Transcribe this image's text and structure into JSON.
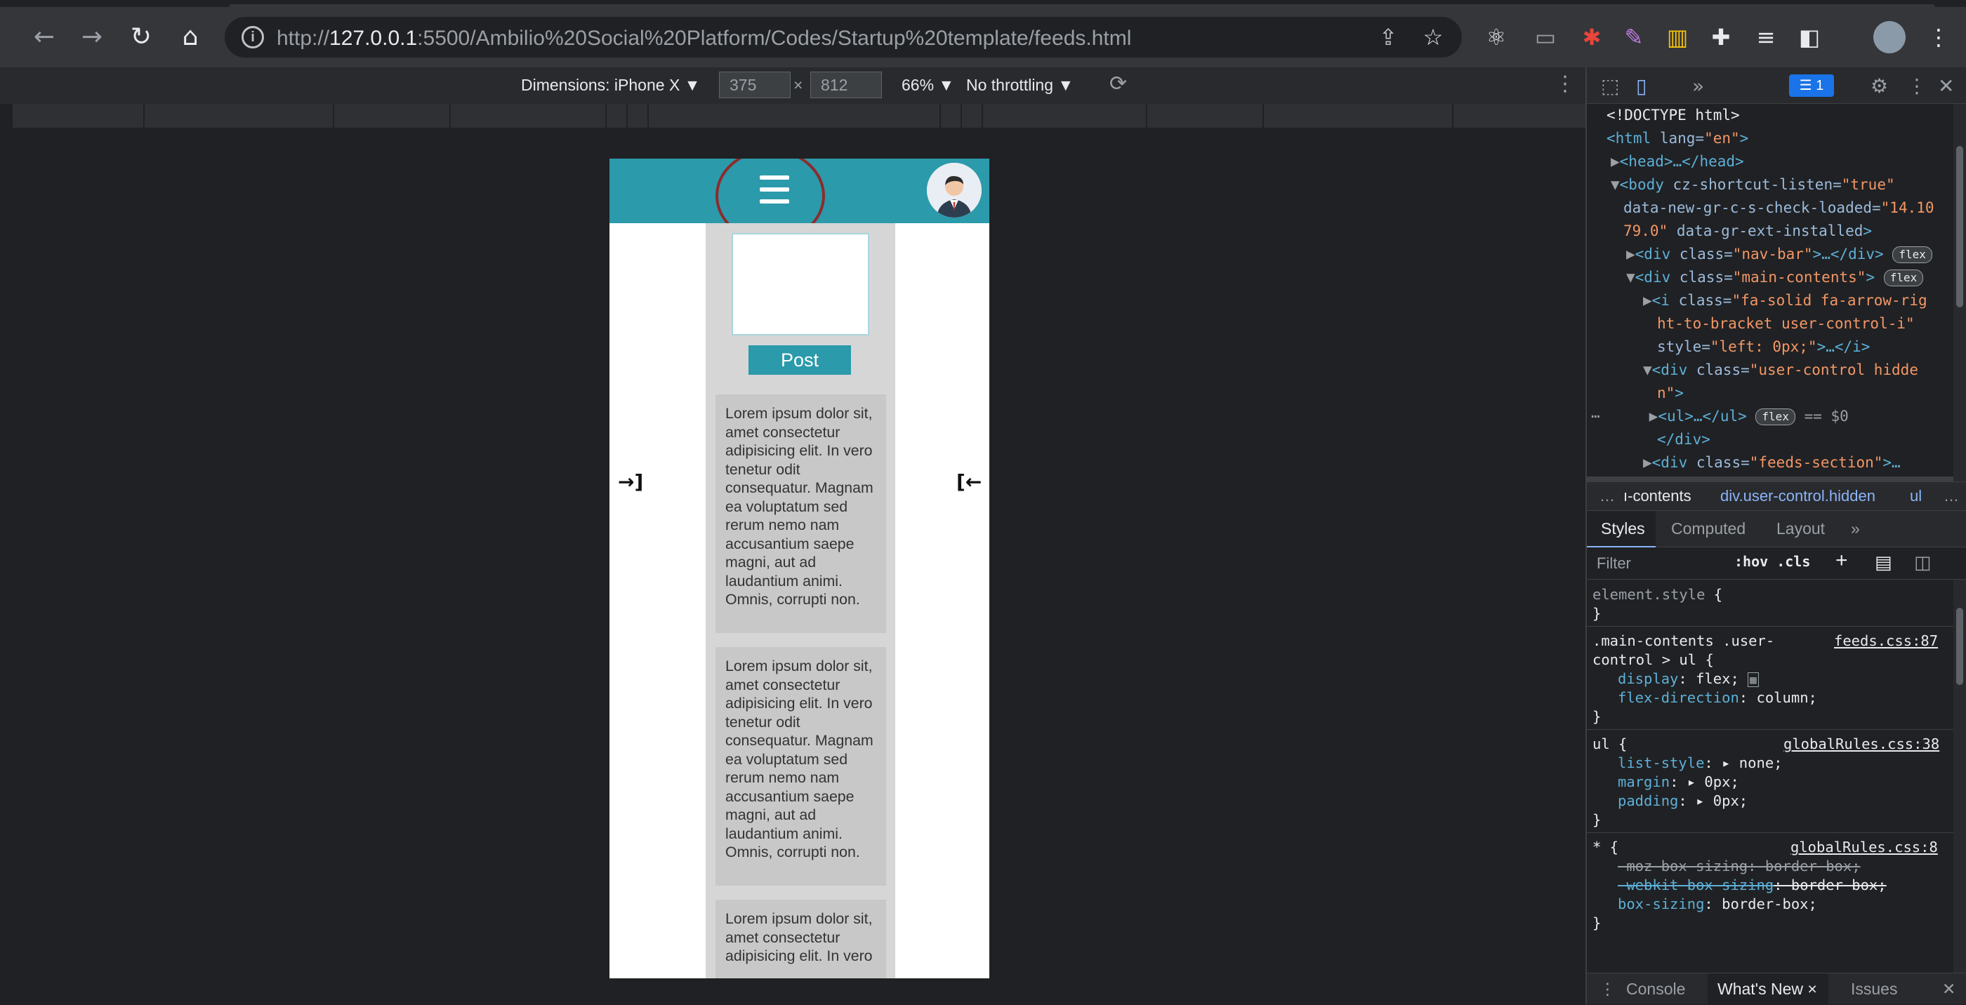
{
  "browser": {
    "url_prefix": "http://",
    "url_host": "127.0.0.1",
    "url_rest": ":5500/Ambilio%20Social%20Platform/Codes/Startup%20template/feeds.html"
  },
  "device_toolbar": {
    "dimensions_label": "Dimensions: iPhone X ▼",
    "width": "375",
    "times": "×",
    "height": "812",
    "zoom": "66% ▼",
    "throttling": "No throttling ▼"
  },
  "page": {
    "post_button": "Post",
    "posts": [
      "Lorem ipsum dolor sit, amet consectetur adipisicing elit. In vero tenetur odit consequatur. Magnam ea voluptatum sed rerum nemo nam accusantium saepe magni, aut ad laudantium animi. Omnis, corrupti non.",
      "Lorem ipsum dolor sit, amet consectetur adipisicing elit. In vero tenetur odit consequatur. Magnam ea voluptatum sed rerum nemo nam accusantium saepe magni, aut ad laudantium animi. Omnis, corrupti non.",
      "Lorem ipsum dolor sit, amet consectetur adipisicing elit. In vero"
    ],
    "left_icon": "→]",
    "right_icon": "[←"
  },
  "devtools": {
    "issues_count": "1",
    "dom": {
      "l1": "<!DOCTYPE html>",
      "l2_tag": "<html",
      "l2_attr": " lang=",
      "l2_val": "\"en\"",
      "l2_end": ">",
      "l3": "<head>…</head>",
      "l4_tag": "<body",
      "l4_attr": " cz-shortcut-listen=",
      "l4_val": "\"true\"",
      "l5_attr": "data-new-gr-c-s-check-loaded=",
      "l5_val": "\"14.10",
      "l6_val": "79.0\"",
      "l6_attr": " data-gr-ext-installed",
      "l6_end": ">",
      "l7_tag": "<div",
      "l7_attr": " class=",
      "l7_val": "\"nav-bar\"",
      "l7_end": ">…</div>",
      "l8_tag": "<div",
      "l8_attr": " class=",
      "l8_val": "\"main-contents\"",
      "l8_end": ">",
      "l9_tag": "<i",
      "l9_attr": " class=",
      "l9_val": "\"fa-solid fa-arrow-rig",
      "l10_val": "ht-to-bracket user-control-i\"",
      "l11_attr": "style=",
      "l11_val": "\"left: 0px;\"",
      "l11_end": ">…</i>",
      "l12_tag": "<div",
      "l12_attr": " class=",
      "l12_val": "\"user-control hidde",
      "l13_val": "n\"",
      "l13_end": ">",
      "l14_tag": "<ul>…</ul>",
      "l14_eq": "== $0",
      "l15": "</div>",
      "l16_tag": "<div",
      "l16_attr": " class=",
      "l16_val": "\"feeds-section\"",
      "l16_end": ">…",
      "flex": "flex"
    },
    "crumbs": [
      "…",
      "ı-contents",
      "div.user-control.hidden",
      "ul",
      "…"
    ],
    "tabs": [
      "Styles",
      "Computed",
      "Layout",
      "»"
    ],
    "filter_placeholder": "Filter",
    "filter_tools": ":hov  .cls",
    "styles": {
      "element_style": "element.style {",
      "close": "}",
      "r1_sel": ".main-contents .user-",
      "r1_sel2": "control > ul {",
      "r1_src": "feeds.css:87",
      "r1_p1": "display",
      "r1_v1": ": flex;",
      "r1_p2": "flex-direction",
      "r1_v2": ": column;",
      "r2_sel": "ul {",
      "r2_src": "globalRules.css:38",
      "r2_p1": "list-style",
      "r2_v1": ": ▸ none;",
      "r2_p2": "margin",
      "r2_v2": ": ▸ 0px;",
      "r2_p3": "padding",
      "r2_v3": ": ▸ 0px;",
      "r3_sel": "* {",
      "r3_src": "globalRules.css:8",
      "r3_s1": "-moz-box-sizing: border-box;",
      "r3_s2a": "-webkit-box-sizing",
      "r3_s2b": ": border-box;",
      "r3_p3": "box-sizing",
      "r3_v3": ": border-box;"
    },
    "drawer": [
      "Console",
      "What's New ×",
      "Issues"
    ]
  }
}
